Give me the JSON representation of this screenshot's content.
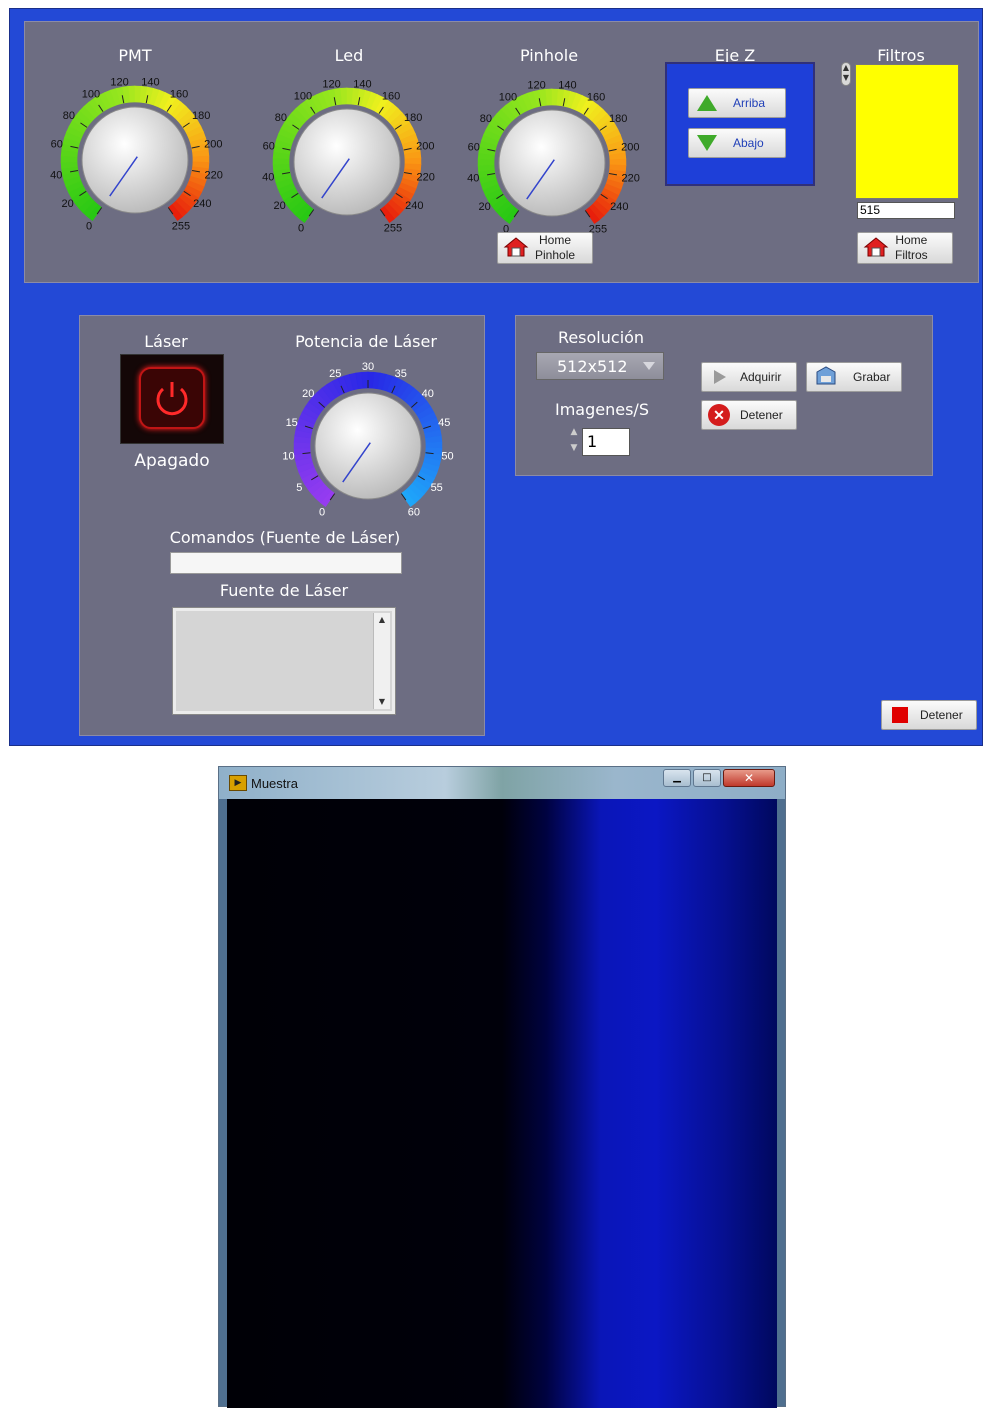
{
  "gauges": [
    {
      "id": "pmt",
      "title": "PMT",
      "ticks": [
        "0",
        "20",
        "40",
        "60",
        "80",
        "100",
        "120",
        "140",
        "160",
        "180",
        "200",
        "220",
        "240",
        "255"
      ]
    },
    {
      "id": "led",
      "title": "Led",
      "ticks": [
        "0",
        "20",
        "40",
        "60",
        "80",
        "100",
        "120",
        "140",
        "160",
        "180",
        "200",
        "220",
        "240",
        "255"
      ]
    },
    {
      "id": "pinhole",
      "title": "Pinhole",
      "ticks": [
        "0",
        "20",
        "40",
        "60",
        "80",
        "100",
        "120",
        "140",
        "160",
        "180",
        "200",
        "220",
        "240",
        "255"
      ]
    }
  ],
  "gauge_value": 0,
  "ejez": {
    "title": "Eje Z",
    "up_label": "Arriba",
    "down_label": "Abajo"
  },
  "filtros": {
    "title": "Filtros",
    "value": "515",
    "color": "#ffff00"
  },
  "home_pinhole": {
    "line1": "Home",
    "line2": "Pinhole"
  },
  "home_filtros": {
    "line1": "Home",
    "line2": "Filtros"
  },
  "laser": {
    "title": "Láser",
    "state": "Apagado"
  },
  "potencia": {
    "title": "Potencia de Láser",
    "ticks": [
      "0",
      "5",
      "10",
      "15",
      "20",
      "25",
      "30",
      "35",
      "40",
      "45",
      "50",
      "55",
      "60"
    ],
    "value": 0
  },
  "comandos": {
    "label": "Comandos (Fuente de Láser)",
    "value": ""
  },
  "fuente": {
    "label": "Fuente de Láser"
  },
  "resolucion": {
    "label": "Resolución",
    "value": "512x512"
  },
  "imagenes": {
    "label": "Imagenes/S",
    "value": "1"
  },
  "buttons": {
    "adquirir": "Adquirir",
    "grabar": "Grabar",
    "detener": "Detener",
    "detener_main": "Detener"
  },
  "window": {
    "title": "Muestra"
  },
  "colors": {
    "panel": "#2349d6",
    "gray": "#6d6d82",
    "ejez_bg": "#1e3fd8"
  }
}
